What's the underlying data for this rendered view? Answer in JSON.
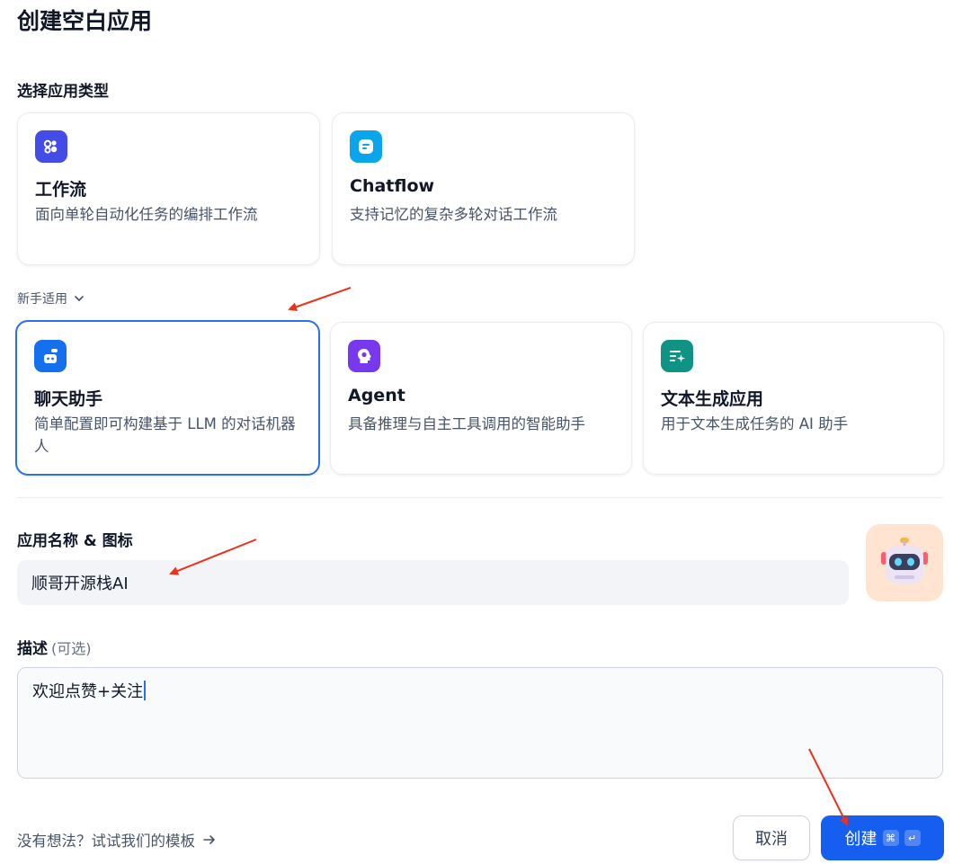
{
  "page": {
    "title": "创建空白应用"
  },
  "app_type": {
    "label": "选择应用类型",
    "primary_cards": [
      {
        "title": "工作流",
        "desc": "面向单轮自动化任务的编排工作流",
        "icon": "workflow-icon",
        "color": "#444ce7"
      },
      {
        "title": "Chatflow",
        "desc": "支持记忆的复杂多轮对话工作流",
        "icon": "chatflow-icon",
        "color": "#0ba5ec"
      }
    ],
    "beginner_toggle": "新手适用",
    "beginner_cards": [
      {
        "title": "聊天助手",
        "desc": "简单配置即可构建基于 LLM 的对话机器人",
        "icon": "chat-assistant-icon",
        "color": "#1570ef",
        "selected": true
      },
      {
        "title": "Agent",
        "desc": "具备推理与自主工具调用的智能助手",
        "icon": "agent-icon",
        "color": "#7839ee"
      },
      {
        "title": "文本生成应用",
        "desc": "用于文本生成任务的 AI 助手",
        "icon": "text-generation-icon",
        "color": "#0e9384"
      }
    ]
  },
  "name_field": {
    "label": "应用名称 & 图标",
    "value": "顺哥开源栈AI",
    "avatar_icon": "robot-avatar-icon"
  },
  "desc_field": {
    "label": "描述",
    "optional": "(可选)",
    "value": "欢迎点赞+关注"
  },
  "footer": {
    "template_link": "没有想法？试试我们的模板",
    "cancel_label": "取消",
    "create_label": "创建",
    "shortcut_cmd": "⌘",
    "shortcut_enter": "↵"
  },
  "colors": {
    "primary": "#155eef",
    "selected_border": "#2b6ff0",
    "annotation_arrow": "#e8341c"
  }
}
